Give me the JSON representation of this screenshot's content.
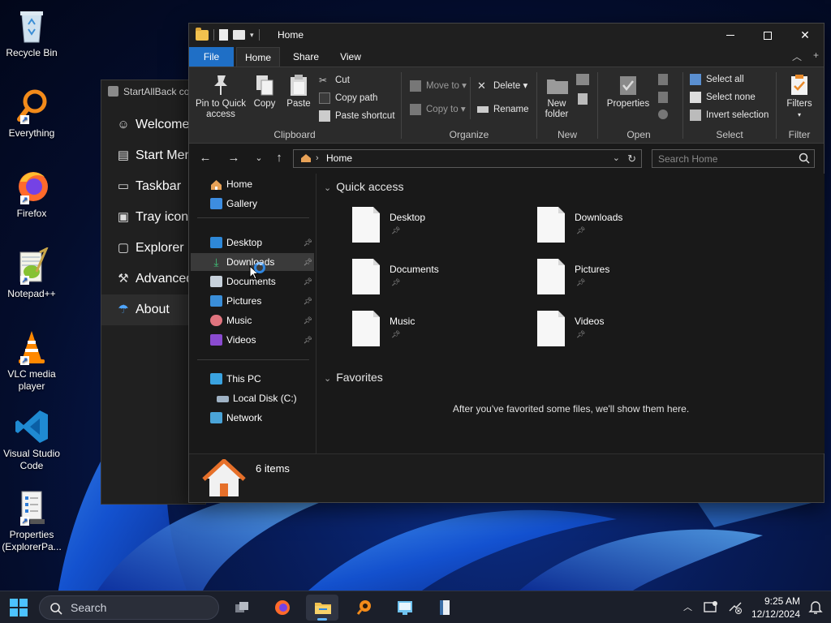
{
  "desktop": {
    "icons": [
      {
        "label": "Recycle Bin",
        "icon": "recycle-bin-icon"
      },
      {
        "label": "Everything",
        "icon": "everything-search-icon"
      },
      {
        "label": "Firefox",
        "icon": "firefox-icon"
      },
      {
        "label": "Notepad++",
        "icon": "notepad-plus-plus-icon"
      },
      {
        "label": "VLC media player",
        "icon": "vlc-cone-icon"
      },
      {
        "label": "Visual Studio Code",
        "icon": "vscode-icon"
      },
      {
        "label": "Properties (ExplorerPa...",
        "icon": "properties-doc-icon"
      }
    ]
  },
  "startallback": {
    "title": "StartAllBack co",
    "items": [
      {
        "label": "Welcome",
        "icon": "smiley-icon"
      },
      {
        "label": "Start Menu",
        "icon": "start-menu-icon"
      },
      {
        "label": "Taskbar",
        "icon": "taskbar-icon"
      },
      {
        "label": "Tray icons",
        "icon": "tray-icon"
      },
      {
        "label": "Explorer",
        "icon": "folder-icon"
      },
      {
        "label": "Advanced",
        "icon": "wrench-icon"
      },
      {
        "label": "About",
        "icon": "about-icon"
      }
    ]
  },
  "explorer": {
    "title": "Home",
    "ribbon_tabs": [
      "File",
      "Home",
      "Share",
      "View"
    ],
    "ribbon": {
      "clipboard": {
        "label": "Clipboard",
        "pin": "Pin to Quick access",
        "copy": "Copy",
        "paste": "Paste",
        "cut": "Cut",
        "copy_path": "Copy path",
        "paste_shortcut": "Paste shortcut"
      },
      "organize": {
        "label": "Organize",
        "move_to": "Move to",
        "copy_to": "Copy to",
        "delete": "Delete",
        "rename": "Rename"
      },
      "new": {
        "label": "New",
        "new_folder": "New folder"
      },
      "open": {
        "label": "Open",
        "properties": "Properties"
      },
      "select": {
        "label": "Select",
        "select_all": "Select all",
        "select_none": "Select none",
        "invert_selection": "Invert selection"
      },
      "filter": {
        "label": "Filter",
        "filters": "Filters"
      }
    },
    "address": {
      "breadcrumb": "Home",
      "search_placeholder": "Search Home"
    },
    "nav": {
      "home": "Home",
      "gallery": "Gallery",
      "pinned": [
        "Desktop",
        "Downloads",
        "Documents",
        "Pictures",
        "Music",
        "Videos"
      ],
      "this_pc": "This PC",
      "local_disk": "Local Disk (C:)",
      "network": "Network"
    },
    "quick_access": {
      "header": "Quick access",
      "items": [
        "Desktop",
        "Downloads",
        "Documents",
        "Pictures",
        "Music",
        "Videos"
      ]
    },
    "favorites": {
      "header": "Favorites",
      "empty_message": "After you've favorited some files, we'll show them here."
    },
    "status": {
      "count": "6 items"
    }
  },
  "taskbar": {
    "search_label": "Search",
    "apps": [
      "task-view",
      "firefox",
      "file-explorer",
      "everything",
      "control-panel",
      "notebook"
    ],
    "time": "9:25 AM",
    "date": "12/12/2024"
  },
  "colors": {
    "accent": "#1f6fc6",
    "window_bg": "#191919",
    "ribbon_bg": "#2b2b2b",
    "folder_yellow": "#f2c14e"
  }
}
